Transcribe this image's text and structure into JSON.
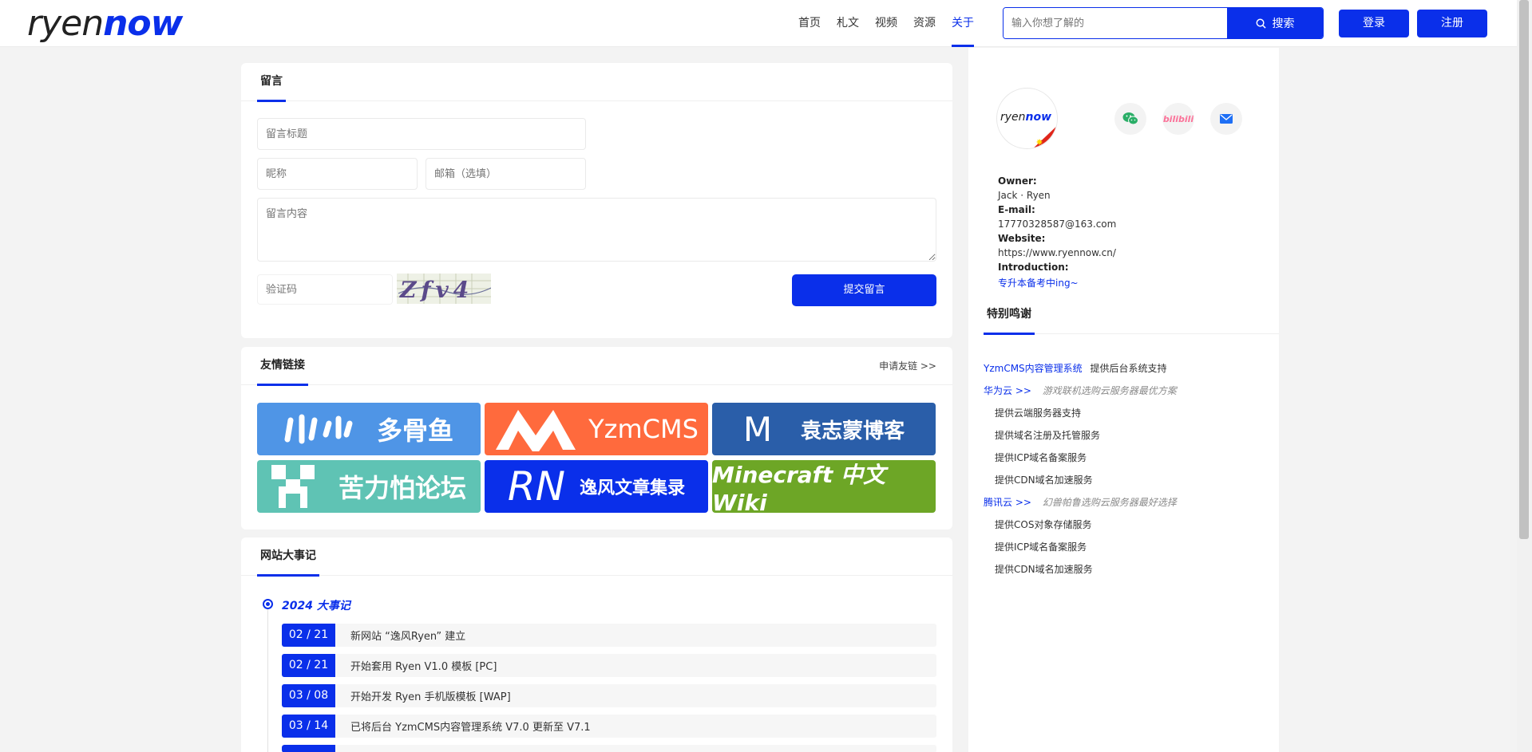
{
  "header": {
    "logo_part1": "ryen",
    "logo_part2": "now",
    "nav": [
      "首页",
      "札文",
      "视频",
      "资源",
      "关于"
    ],
    "nav_active_index": 4,
    "search_placeholder": "输入你想了解的",
    "search_button": "搜索",
    "login": "登录",
    "register": "注册"
  },
  "message_panel": {
    "title": "留言",
    "title_placeholder": "留言标题",
    "nickname_placeholder": "昵称",
    "email_placeholder": "邮箱（选填）",
    "content_placeholder": "留言内容",
    "captcha_placeholder": "验证码",
    "captcha_text": "Zfv4",
    "submit": "提交留言"
  },
  "friends_panel": {
    "title": "友情链接",
    "apply": "申请友链 >>",
    "links": [
      {
        "label": "多骨鱼",
        "color": "#4f95e6"
      },
      {
        "label": "YzmCMS",
        "color": "#ff6a3d"
      },
      {
        "label": "袁志蒙博客",
        "color": "#2a5ea9"
      },
      {
        "label": "苦力怕论坛",
        "color": "#5fc3b4"
      },
      {
        "label": "逸风文章集录",
        "color": "#0a2fea"
      },
      {
        "label": "Minecraft 中文 Wiki",
        "color": "#6da626"
      }
    ]
  },
  "events_panel": {
    "title": "网站大事记",
    "year": "2024 大事记",
    "events": [
      {
        "date": "02 / 21",
        "text": "新网站 “逸风Ryen” 建立"
      },
      {
        "date": "02 / 21",
        "text": "开始套用 Ryen V1.0 模板 [PC]"
      },
      {
        "date": "03 / 08",
        "text": "开始开发 Ryen 手机版模板 [WAP]"
      },
      {
        "date": "03 / 14",
        "text": "已将后台 YzmCMS内容管理系统 V7.0 更新至 V7.1"
      }
    ]
  },
  "sidebar": {
    "avatar_part1": "ryen",
    "avatar_part2": "now",
    "owner_label": "Owner:",
    "owner": "Jack · Ryen",
    "email_label": "E-mail:",
    "email": "17770328587@163.com",
    "website_label": "Website:",
    "website": "https://www.ryennow.cn/",
    "intro_label": "Introduction:",
    "intro": "专升本备考中ing~",
    "social_icons": [
      "wechat-icon",
      "bilibili-icon",
      "mail-icon"
    ],
    "bilibili_text": "bilibili",
    "thanks_title": "特别鸣谢",
    "thanks": {
      "yzm_name": "YzmCMS内容管理系统",
      "yzm_desc": "提供后台系统支持",
      "huawei_name": "华为云 >>",
      "huawei_slogan": "游戏联机选购云服务器最优方案",
      "huawei_items": [
        "提供云端服务器支持",
        "提供域名注册及托管服务",
        "提供ICP域名备案服务",
        "提供CDN域名加速服务"
      ],
      "tencent_name": "腾讯云 >>",
      "tencent_slogan": "幻兽帕鲁选购云服务器最好选择",
      "tencent_items": [
        "提供COS对象存储服务",
        "提供ICP域名备案服务",
        "提供CDN域名加速服务"
      ]
    }
  },
  "colors": {
    "accent": "#0a2fea"
  }
}
